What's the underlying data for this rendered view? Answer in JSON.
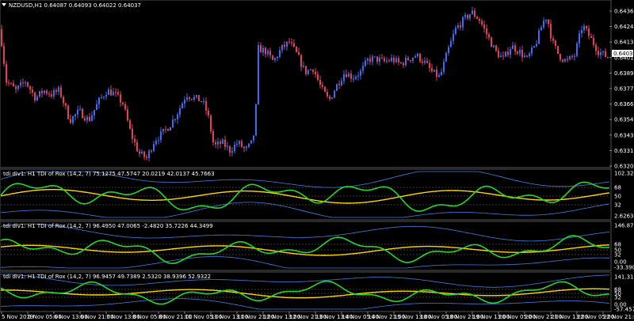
{
  "main": {
    "header": "NZDUSD,H1  0.64087 0.64093 0.64022 0.64037",
    "price_labels": [
      "0.64360",
      "0.64245",
      "0.64130",
      "0.64015",
      "0.63899",
      "0.63775",
      "0.63660",
      "0.63545",
      "0.63430",
      "0.63315",
      "0.63200"
    ],
    "current_price": "0.64037"
  },
  "indicators": [
    {
      "header": "tdi div1: H1 TDI of Rox (14,2, 7) 75.1275 47.5747 20.0219 42.0137 45.7663",
      "scale": [
        "102.3248",
        "68",
        "50",
        "32",
        "2.6263"
      ]
    },
    {
      "header": "tdi div1: H1 TDI of Rox (14,2, 7) 96.4950 47.0065 -2.4820 35.7226 44.3499",
      "scale": [
        "146.8733",
        "68",
        "50",
        "32",
        "0.00",
        "-33.3904"
      ]
    },
    {
      "header": "tdi div1: H1 TDI of Rox (14,2, 7) 96.9457 49.7389 2.5320 38.9396 52.9322",
      "scale": [
        "141.318",
        "68",
        "50",
        "32",
        "0.00",
        "-57.457"
      ]
    }
  ],
  "time_labels": [
    "5 Nov 2019",
    "6 Nov 05:00",
    "6 Nov 13:00",
    "6 Nov 21:00",
    "7 Nov 13:00",
    "8 Nov 05:00",
    "8 Nov 21:00",
    "11 Nov 05:00",
    "11 Nov 13:00",
    "11 Nov 21:00",
    "12 Nov 13:00",
    "12 Nov 21:00",
    "13 Nov 13:00",
    "14 Nov 05:00",
    "14 Nov 21:00",
    "15 Nov 13:00",
    "18 Nov 05:00",
    "18 Nov 21:00",
    "19 Nov 13:00",
    "20 Nov 05:00",
    "20 Nov 21:00",
    "21 Nov 13:00",
    "22 Nov 05:00",
    "22 Nov 21:00"
  ],
  "colors": {
    "background": "#000000",
    "bull": "#3d6cf0",
    "bear": "#e0405a",
    "green_line": "#27d62a",
    "yellow_line": "#ffd700",
    "band": "#3f7fe0",
    "grid": "#2a2a2a"
  },
  "chart_data": {
    "type": "candlestick",
    "price_anchors": [
      [
        0,
        0.6425
      ],
      [
        8,
        0.6385
      ],
      [
        20,
        0.6378
      ],
      [
        32,
        0.6385
      ],
      [
        45,
        0.6372
      ],
      [
        55,
        0.6378
      ],
      [
        65,
        0.6375
      ],
      [
        75,
        0.6378
      ],
      [
        88,
        0.6355
      ],
      [
        100,
        0.6362
      ],
      [
        112,
        0.6355
      ],
      [
        125,
        0.637
      ],
      [
        135,
        0.6378
      ],
      [
        145,
        0.6375
      ],
      [
        155,
        0.6368
      ],
      [
        165,
        0.6345
      ],
      [
        175,
        0.633
      ],
      [
        185,
        0.6326
      ],
      [
        195,
        0.634
      ],
      [
        205,
        0.6345
      ],
      [
        215,
        0.6352
      ],
      [
        225,
        0.6362
      ],
      [
        235,
        0.6375
      ],
      [
        245,
        0.6372
      ],
      [
        255,
        0.637
      ],
      [
        262,
        0.636
      ],
      [
        270,
        0.6335
      ],
      [
        280,
        0.6338
      ],
      [
        290,
        0.6332
      ],
      [
        300,
        0.6338
      ],
      [
        310,
        0.6332
      ],
      [
        318,
        0.6338
      ],
      [
        322,
        0.635
      ],
      [
        326,
        0.641
      ],
      [
        335,
        0.6408
      ],
      [
        345,
        0.64
      ],
      [
        355,
        0.641
      ],
      [
        365,
        0.6415
      ],
      [
        375,
        0.6405
      ],
      [
        385,
        0.6392
      ],
      [
        395,
        0.6395
      ],
      [
        405,
        0.638
      ],
      [
        415,
        0.637
      ],
      [
        425,
        0.6382
      ],
      [
        435,
        0.6392
      ],
      [
        445,
        0.6388
      ],
      [
        455,
        0.6392
      ],
      [
        465,
        0.6402
      ],
      [
        475,
        0.6402
      ],
      [
        485,
        0.64
      ],
      [
        495,
        0.6402
      ],
      [
        505,
        0.6398
      ],
      [
        515,
        0.6402
      ],
      [
        525,
        0.6405
      ],
      [
        535,
        0.64
      ],
      [
        545,
        0.6392
      ],
      [
        555,
        0.6388
      ],
      [
        565,
        0.6408
      ],
      [
        575,
        0.6425
      ],
      [
        585,
        0.6432
      ],
      [
        595,
        0.6438
      ],
      [
        605,
        0.6432
      ],
      [
        615,
        0.642
      ],
      [
        625,
        0.6408
      ],
      [
        635,
        0.6402
      ],
      [
        645,
        0.6412
      ],
      [
        655,
        0.6408
      ],
      [
        665,
        0.6402
      ],
      [
        675,
        0.6412
      ],
      [
        685,
        0.643
      ],
      [
        690,
        0.6435
      ],
      [
        697,
        0.6415
      ],
      [
        705,
        0.6405
      ],
      [
        715,
        0.64
      ],
      [
        725,
        0.6405
      ],
      [
        735,
        0.6428
      ],
      [
        745,
        0.6418
      ],
      [
        755,
        0.6408
      ],
      [
        765,
        0.6404
      ]
    ],
    "price_ylim": [
      0.632,
      0.644
    ]
  }
}
